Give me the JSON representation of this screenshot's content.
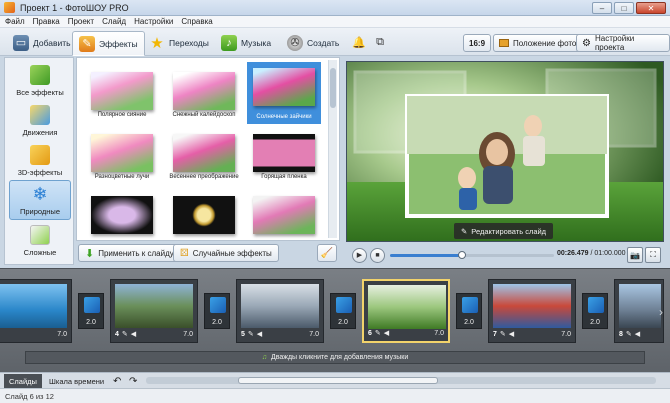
{
  "window": {
    "title": "Проект 1 - ФотоШОУ PRO",
    "minimize": "–",
    "maximize": "□",
    "close": "✕"
  },
  "menu": [
    "Файл",
    "Правка",
    "Проект",
    "Слайд",
    "Настройки",
    "Справка"
  ],
  "toolbar": {
    "tabs": [
      {
        "label": "Добавить",
        "icon": "folder-icon"
      },
      {
        "label": "Эффекты",
        "icon": "effects-icon"
      },
      {
        "label": "Переходы",
        "icon": "star-icon"
      },
      {
        "label": "Музыка",
        "icon": "music-icon"
      },
      {
        "label": "Создать",
        "icon": "film-reel-icon"
      }
    ],
    "active_tab": "Эффекты",
    "aspect_label": "16:9",
    "photo_position_label": "Положение фото",
    "project_settings_label": "Настройки проекта"
  },
  "categories": [
    {
      "label": "Все эффекты",
      "icon": "puzzle-icon",
      "active": false
    },
    {
      "label": "Движения",
      "icon": "movement-icon",
      "active": false
    },
    {
      "label": "3D-эффекты",
      "icon": "cube-icon",
      "active": false
    },
    {
      "label": "Природные",
      "icon": "snowflake-icon",
      "active": true
    },
    {
      "label": "Сложные",
      "icon": "complex-icon",
      "active": false
    }
  ],
  "effects": [
    {
      "label": "Полярное сияние",
      "selected": false
    },
    {
      "label": "Снежный калейдоскоп",
      "selected": false
    },
    {
      "label": "Солнечные зайчики",
      "selected": true
    },
    {
      "label": "Разноцветные лучи",
      "selected": false
    },
    {
      "label": "Весеннее преображение",
      "selected": false
    },
    {
      "label": "Горящая пленка",
      "selected": false
    },
    {
      "label": "",
      "selected": false
    },
    {
      "label": "",
      "selected": false
    },
    {
      "label": "",
      "selected": false
    }
  ],
  "actions": {
    "apply_label": "Применить к слайду",
    "random_label": "Случайные эффекты"
  },
  "preview": {
    "edit_slide_label": "Редактировать слайд",
    "time_current": "00:26.479",
    "time_total": "01:00.000",
    "time_separator": " / ",
    "progress": 0.44
  },
  "timeline": {
    "slides": [
      {
        "number": "",
        "duration": "7.0"
      },
      {
        "number": "4",
        "duration": "7.0"
      },
      {
        "number": "5",
        "duration": "7.0"
      },
      {
        "number": "6",
        "duration": "7.0",
        "current": true
      },
      {
        "number": "7",
        "duration": "7.0"
      },
      {
        "number": "8",
        "duration": "7.0"
      }
    ],
    "transitions": [
      "2.0",
      "2.0",
      "2.0",
      "2.0",
      "2.0"
    ],
    "music_hint": "Дважды кликните для добавления музыки"
  },
  "bottom_tabs": [
    "Слайды",
    "Шкала времени"
  ],
  "status": "Слайд 6 из 12",
  "colors": {
    "accent": "#3f8fdc",
    "current_slide_border": "#f2d36b",
    "timeline_bg": "#6a6f75"
  }
}
